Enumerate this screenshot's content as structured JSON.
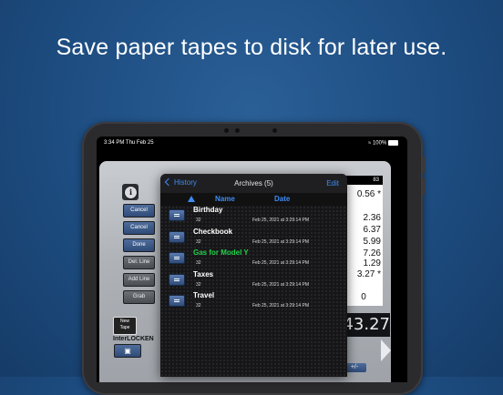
{
  "headline": "Save paper tapes to disk for later use.",
  "status_bar": {
    "time_date": "3:34 PM  Thu Feb 25",
    "battery": "100%"
  },
  "calculator": {
    "side_buttons": [
      "Cancel",
      "Cancel",
      "Done",
      "Del. Line",
      "Add Line",
      "Grab"
    ],
    "new_tape": [
      "New",
      "Tape"
    ],
    "interlock_label": "InterLOCKEN",
    "tape_header": "83",
    "tape_values": [
      "0.56 *",
      "2.36",
      "6.37",
      "5.99",
      "7.26",
      "1.29",
      "3.27 *",
      "",
      "0"
    ],
    "display_value": "43.27",
    "plus_minus": "+/-"
  },
  "archives": {
    "back_label": "History",
    "title": "Archives (5)",
    "edit_label": "Edit",
    "columns": {
      "name": "Name",
      "date": "Date"
    },
    "rows": [
      {
        "name": "Birthday",
        "count": "32",
        "date": "Feb 25, 2021 at 3:29:14 PM",
        "highlight": false
      },
      {
        "name": "Checkbook",
        "count": "32",
        "date": "Feb 25, 2021 at 3:29:14 PM",
        "highlight": false
      },
      {
        "name": "Gas for Model Y",
        "count": "32",
        "date": "Feb 25, 2021 at 3:29:14 PM",
        "highlight": true
      },
      {
        "name": "Taxes",
        "count": "32",
        "date": "Feb 25, 2021 at 3:29:14 PM",
        "highlight": false
      },
      {
        "name": "Travel",
        "count": "32",
        "date": "Feb 25, 2021 at 3:29:14 PM",
        "highlight": false
      }
    ],
    "highlight_color": "#21d14a",
    "accent_color": "#3d8cf5"
  }
}
